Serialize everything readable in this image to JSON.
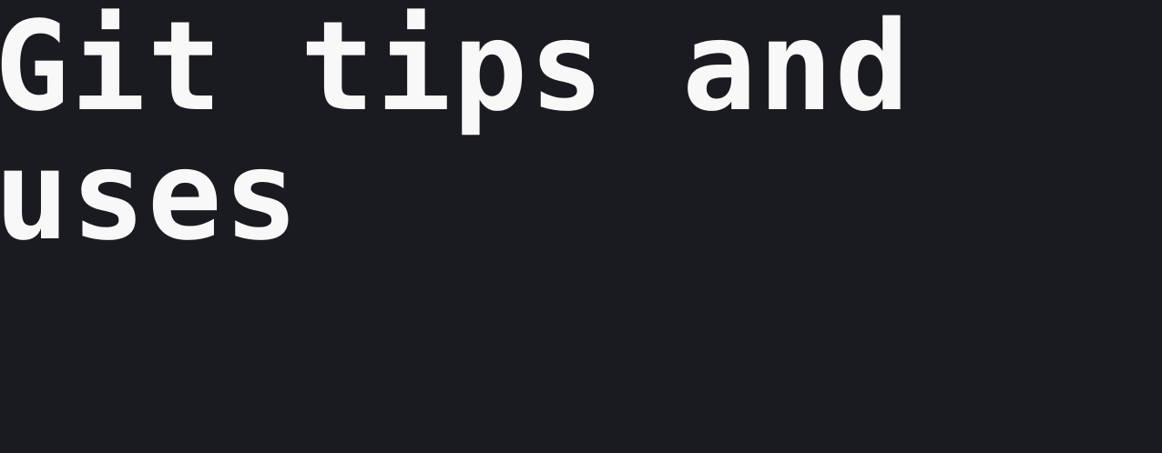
{
  "header": {
    "title_line_1": "Git tips and",
    "title_line_2": "uses"
  },
  "colors": {
    "background": "#1a1b20",
    "text": "#f8f8f8"
  }
}
